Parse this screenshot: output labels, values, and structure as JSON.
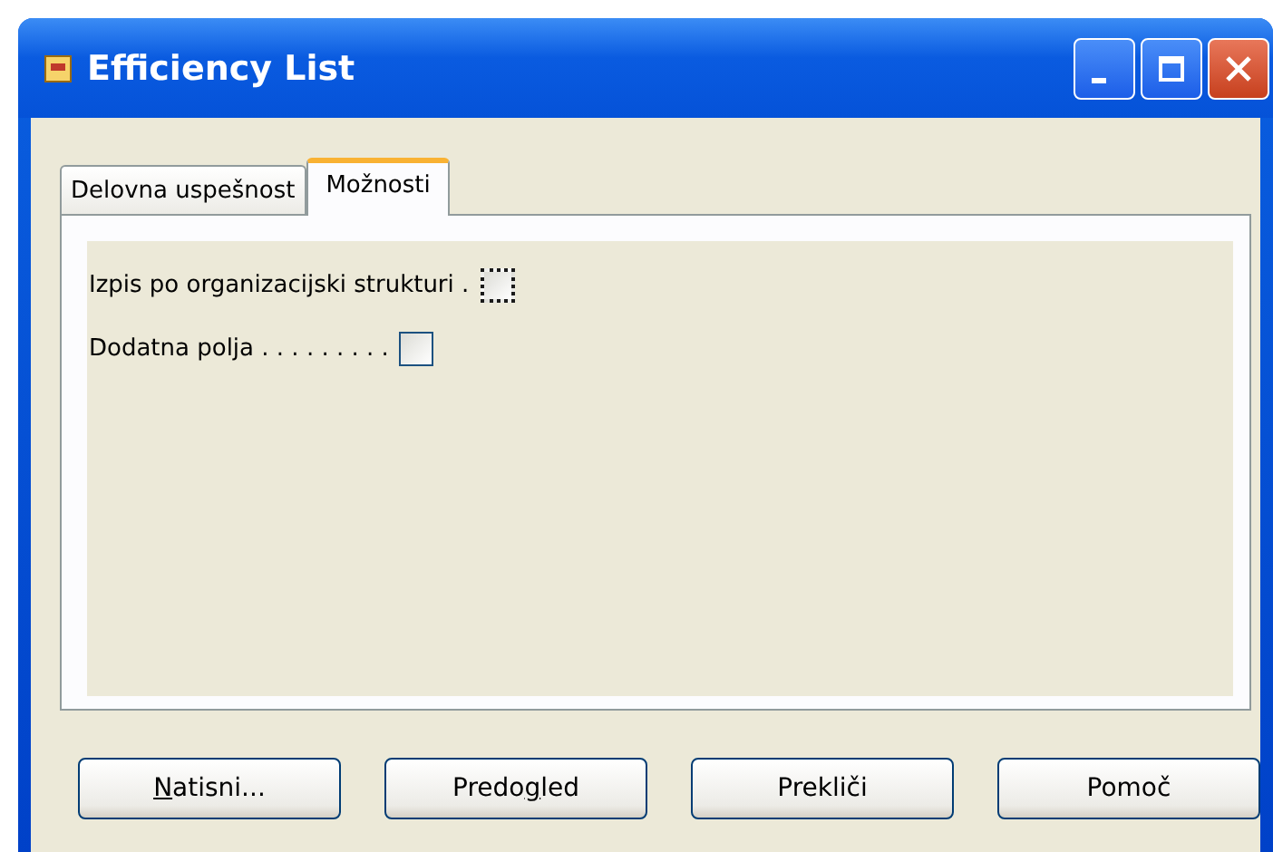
{
  "window": {
    "title": "Efficiency List"
  },
  "tabs": [
    {
      "label": "Delovna uspešnost",
      "selected": false
    },
    {
      "label": "Možnosti",
      "selected": true
    }
  ],
  "options": [
    {
      "label": "Izpis po organizacijski strukturi .",
      "checked": false,
      "focused": true
    },
    {
      "label": "Dodatna polja . . . . . . . . .",
      "checked": false,
      "focused": false
    }
  ],
  "buttons": [
    {
      "key": "N",
      "post": "atisni..."
    },
    {
      "pre": "Predo",
      "key": "g",
      "post": "led"
    },
    {
      "pre": "Prekliči"
    },
    {
      "pre": "Pomoč"
    }
  ]
}
